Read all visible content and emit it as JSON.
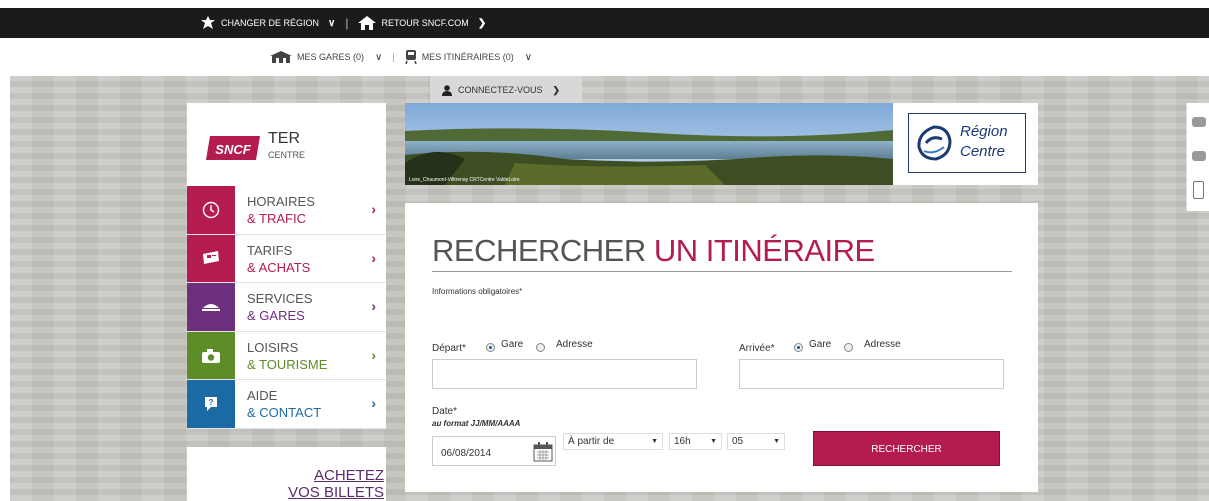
{
  "topbar": {
    "change_region": "CHANGER DE RÉGION",
    "back_sncf": "RETOUR SNCF.COM"
  },
  "subbar": {
    "mes_gares": "MES GARES (0)",
    "mes_itineraires": "MES ITINÉRAIRES (0)"
  },
  "account": {
    "connect_label": "CONNECTEZ-VOUS"
  },
  "brand": {
    "sncf": "SNCF",
    "ter": "TER",
    "region": "CENTRE"
  },
  "menu": {
    "items": [
      {
        "line1": "HORAIRES",
        "line2": "& TRAFIC",
        "color": "#b31b51",
        "icon": "clock-icon"
      },
      {
        "line1": "TARIFS",
        "line2": "& ACHATS",
        "color": "#b31b51",
        "icon": "ticket-icon"
      },
      {
        "line1": "SERVICES",
        "line2": "& GARES",
        "color": "#6e2f7f",
        "icon": "service-icon"
      },
      {
        "line1": "LOISIRS",
        "line2": "& TOURISME",
        "color": "#5c8d27",
        "icon": "camera-icon"
      },
      {
        "line1": "AIDE",
        "line2": "& CONTACT",
        "color": "#1c6aa3",
        "icon": "help-icon"
      }
    ]
  },
  "promo": {
    "line1": "ACHETEZ",
    "line2": "VOS BILLETS"
  },
  "banner": {
    "photo_caption": "Loire_Chaumont-Villtrenay CRTCentre ValdeLoire",
    "region_line1": "Région",
    "region_line2": "Centre"
  },
  "search": {
    "title_part1": "RECHERCHER",
    "title_part2": "UN ITINÉRAIRE",
    "required_note": "Informations obligatoires*",
    "depart_label": "Départ*",
    "arrivee_label": "Arrivée*",
    "option_gare": "Gare",
    "option_adresse": "Adresse",
    "date_label": "Date*",
    "date_format": "au format JJ/MM/AAAA",
    "date_value": "06/08/2014",
    "time_mode": "À partir de",
    "hour": "16h",
    "minute": "05",
    "submit": "RECHERCHER"
  }
}
